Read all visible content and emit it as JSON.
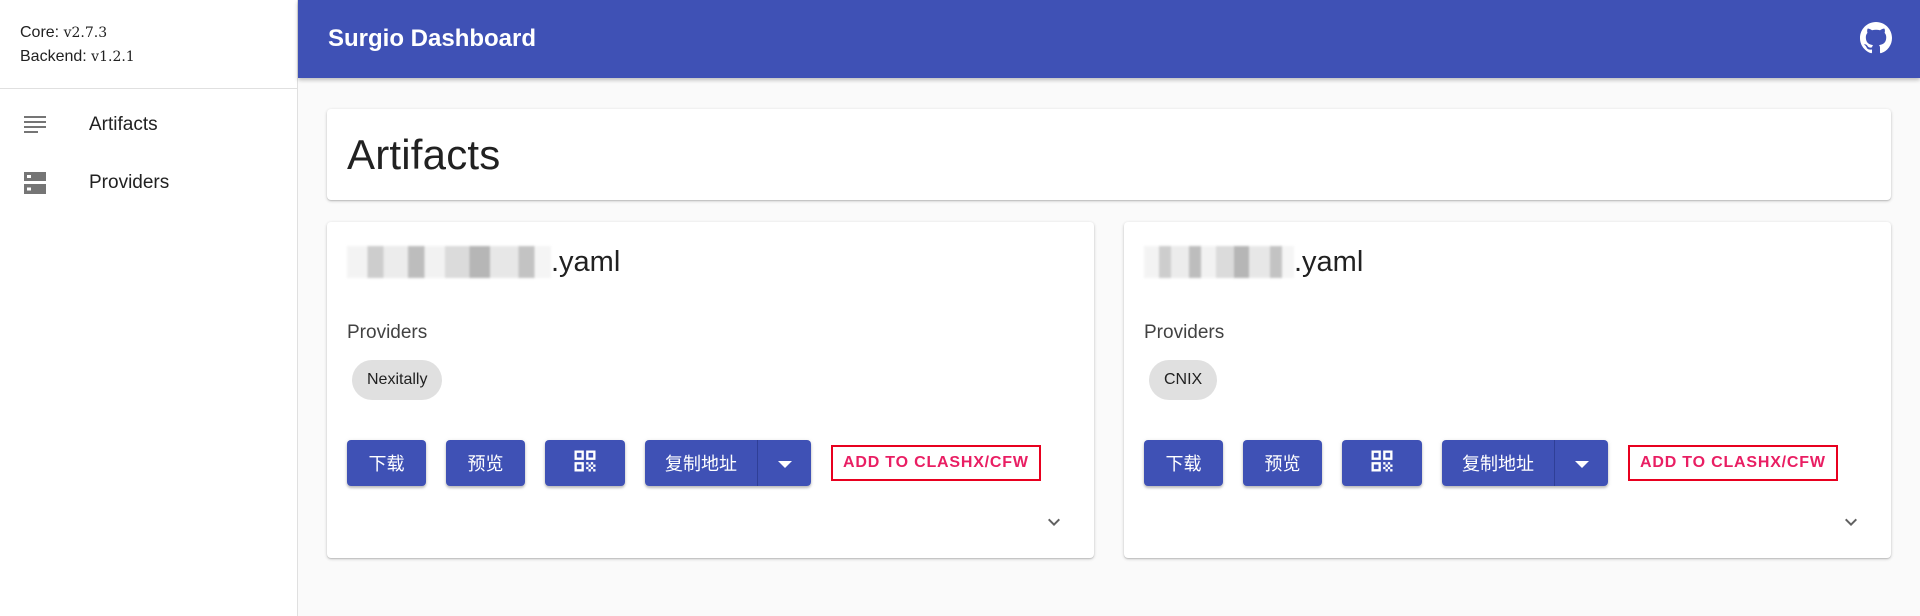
{
  "sidebar": {
    "core_label": "Core:",
    "core_version": "v2.7.3",
    "backend_label": "Backend:",
    "backend_version": "v1.2.1",
    "items": [
      {
        "label": "Artifacts",
        "icon": "list-icon"
      },
      {
        "label": "Providers",
        "icon": "storage-icon"
      }
    ]
  },
  "topbar": {
    "title": "Surgio Dashboard",
    "github_icon": "github-icon",
    "color": "#3f51b5"
  },
  "main": {
    "page_title": "Artifacts",
    "cards": [
      {
        "name_suffix": ".yaml",
        "providers_label": "Providers",
        "providers": [
          "Nexitally"
        ],
        "buttons": {
          "download": "下载",
          "preview": "预览",
          "copy": "复制地址",
          "add": "ADD TO CLASHX/CFW"
        }
      },
      {
        "name_suffix": ".yaml",
        "providers_label": "Providers",
        "providers": [
          "CNIX"
        ],
        "buttons": {
          "download": "下载",
          "preview": "预览",
          "copy": "复制地址",
          "add": "ADD TO CLASHX/CFW"
        }
      }
    ]
  },
  "colors": {
    "primary": "#3f51b5",
    "accent": "#e91e63"
  }
}
